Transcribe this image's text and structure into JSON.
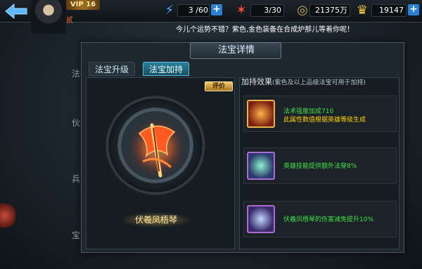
{
  "topbar": {
    "back_icon": "back-arrow-icon",
    "vip_label": "VIP 16",
    "avatar_rank": "贰",
    "stamina": {
      "icon": "lightning-icon",
      "value": "3 /60",
      "color": "#4fa8ff"
    },
    "energy": {
      "icon": "fire-icon",
      "value": "3/30",
      "color": "#ff4a3a"
    },
    "coins": {
      "icon": "coin-icon",
      "value": "21375万",
      "color": "#c8a45a"
    },
    "ingots": {
      "icon": "gold-ingot-icon",
      "value": "19147",
      "color": "#f6c93a"
    }
  },
  "notice": "今儿个运势不错？紫色,金色装备在合成炉那儿等着你呢！",
  "panel": {
    "title": "法宝详情",
    "tabs": [
      {
        "label": "法宝升级",
        "active": false
      },
      {
        "label": "法宝加持",
        "active": true
      }
    ],
    "rate_button": "评价",
    "item_name": "伏羲凤梧琴",
    "effects_title": "加持效果",
    "effects_note": "(紫色及以上品级法宝可用于加持)",
    "effects": [
      {
        "icon": "phoenix-bracelet-icon",
        "line1": "法术强度加成710",
        "line2": "此属性数值根据英雄等级生成"
      },
      {
        "icon": "crystal-orb-icon",
        "line1": "英雄技能提供额外法穿8%",
        "line2": ""
      },
      {
        "icon": "zither-icon",
        "line1": "伏羲凤梧琴的伤害减免提升10%",
        "line2": ""
      }
    ]
  },
  "side": {
    "fragments": [
      "法",
      "伙",
      "兵",
      "宝"
    ]
  }
}
